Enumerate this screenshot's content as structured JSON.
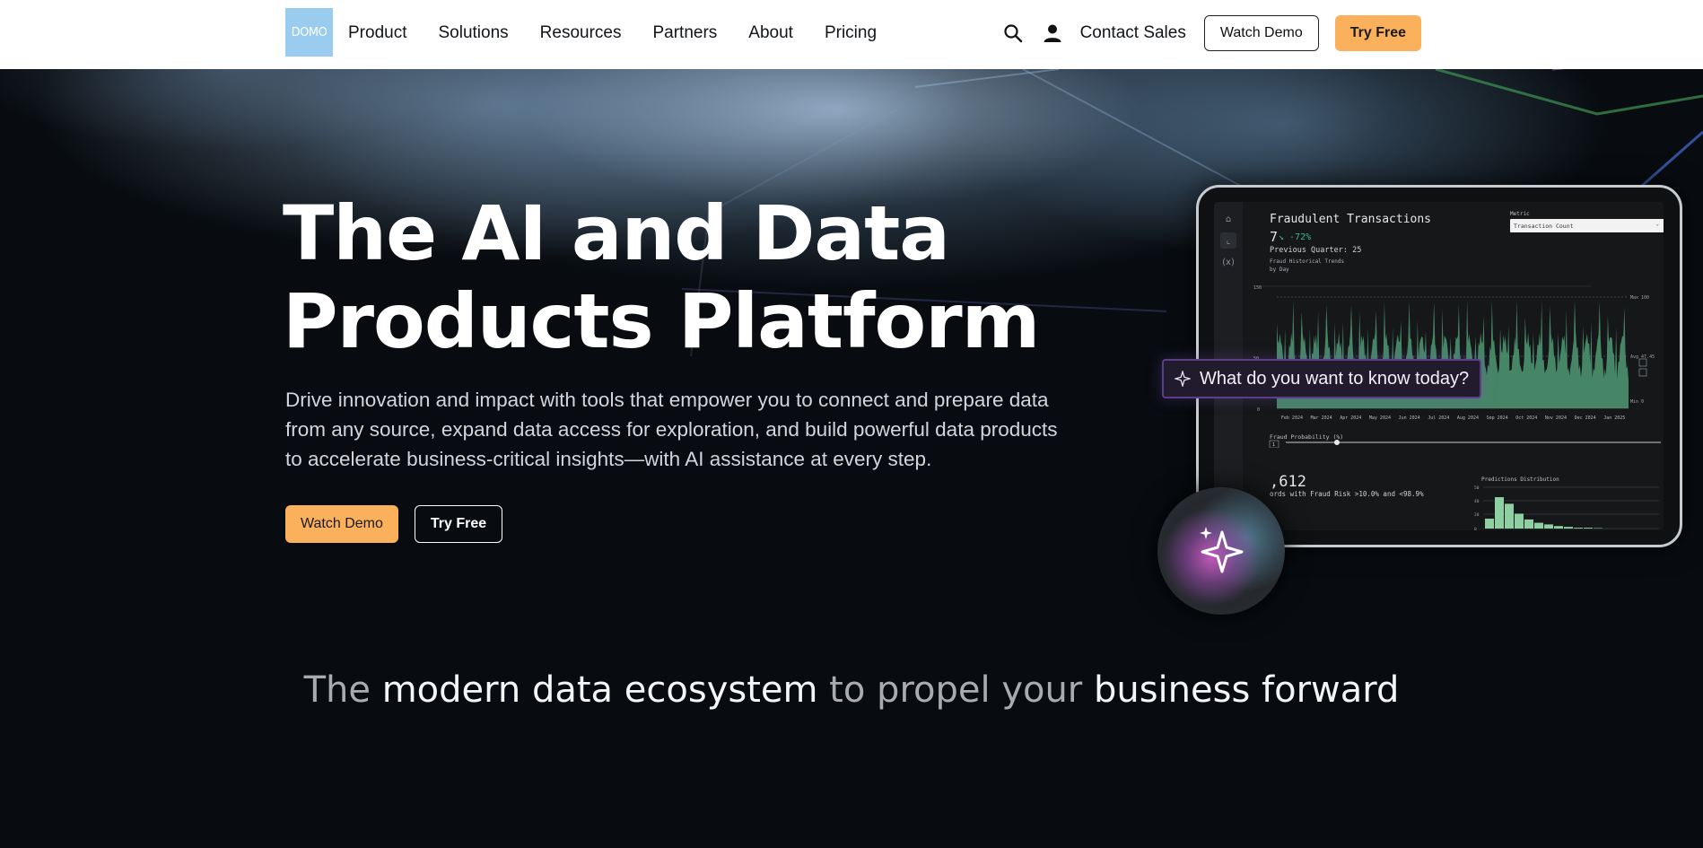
{
  "nav": {
    "logo_text": "DOMO",
    "links": [
      "Product",
      "Solutions",
      "Resources",
      "Partners",
      "About",
      "Pricing"
    ],
    "contact_label": "Contact Sales",
    "watch_demo_label": "Watch Demo",
    "try_free_label": "Try Free"
  },
  "hero": {
    "headline_line1": "The AI and Data",
    "headline_line2": "Products Platform",
    "subcopy": "Drive innovation and impact with tools that empower you to connect and prepare data from any source, expand data access for exploration, and build powerful data products to accelerate business-critical insights—with AI assistance at every step.",
    "watch_demo_label": "Watch Demo",
    "try_free_label": "Try Free"
  },
  "tagline": {
    "part1": "The ",
    "part2": "modern data ecosystem",
    "part3": " to propel your ",
    "part4": "business forward"
  },
  "ai_prompt": {
    "text": "What do you want to know today?"
  },
  "dashboard": {
    "title": "Fraudulent Transactions",
    "value": "7",
    "change": "↘ -72%",
    "previous": "Previous Quarter: 25",
    "trend_title": "Fraud Historical Trends",
    "trend_sub": "by Day",
    "metric_label": "Metric",
    "metric_value": "Transaction Count",
    "y_max": "150",
    "y_mid": "50",
    "y_zero": "0",
    "ref_max": "Max 100",
    "ref_avg": "Avg 47.45",
    "ref_min": "Min 0",
    "months": [
      "Feb 2024",
      "Mar 2024",
      "Apr 2024",
      "May 2024",
      "Jun 2024",
      "Jul 2024",
      "Aug 2024",
      "Sep 2024",
      "Oct 2024",
      "Nov 2024",
      "Dec 2024",
      "Jan 2025"
    ],
    "fraud_prob_label": "Fraud Probability (%)",
    "fraud_prob_input": "1",
    "slider_min": "0",
    "slider_max": "1",
    "big_number": ",612",
    "records_label": "ords with Fraud Risk >10.0% and <98.9%",
    "dist_title": "Predictions Distribution",
    "dist_y": [
      "50",
      "40",
      "20",
      "0"
    ],
    "dist_values": [
      12,
      38,
      30,
      18,
      11,
      7,
      5,
      3,
      2,
      1,
      1,
      0.5
    ]
  },
  "colors": {
    "accent_orange": "#fbb05b",
    "logo_blue": "#99ccee",
    "chart_green": "#4f9a74",
    "dist_green": "#8fd0a3"
  }
}
